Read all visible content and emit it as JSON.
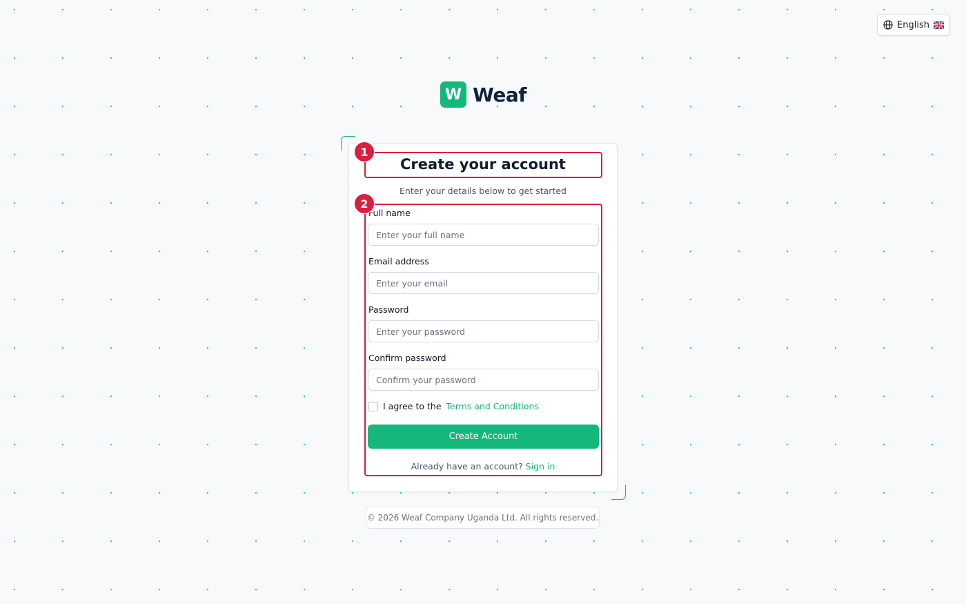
{
  "language": {
    "label": "English",
    "globe_icon": "globe-icon",
    "flag_icon": "uk-flag-icon"
  },
  "brand": {
    "mark": "W",
    "name": "Weaf",
    "color": "#14b87a"
  },
  "form": {
    "title": "Create your account",
    "subtitle": "Enter your details below to get started",
    "fields": [
      {
        "label": "Full name",
        "placeholder": "Enter your full name",
        "value": ""
      },
      {
        "label": "Email address",
        "placeholder": "Enter your email",
        "value": ""
      },
      {
        "label": "Password",
        "placeholder": "Enter your password",
        "value": ""
      },
      {
        "label": "Confirm password",
        "placeholder": "Confirm your password",
        "value": ""
      }
    ],
    "terms": {
      "checked": false,
      "prefix": "I agree to the",
      "link": "Terms and Conditions"
    },
    "submit_label": "Create Account",
    "signin_prompt": "Already have an account?",
    "signin_link": "Sign in"
  },
  "annotations": [
    {
      "number": "1"
    },
    {
      "number": "2"
    }
  ],
  "colors": {
    "accent": "#14b87a",
    "annotation": "#d8203f",
    "background": "#f7f9fa"
  },
  "footer": {
    "text": "© 2026 Weaf Company Uganda Ltd. All rights reserved."
  }
}
